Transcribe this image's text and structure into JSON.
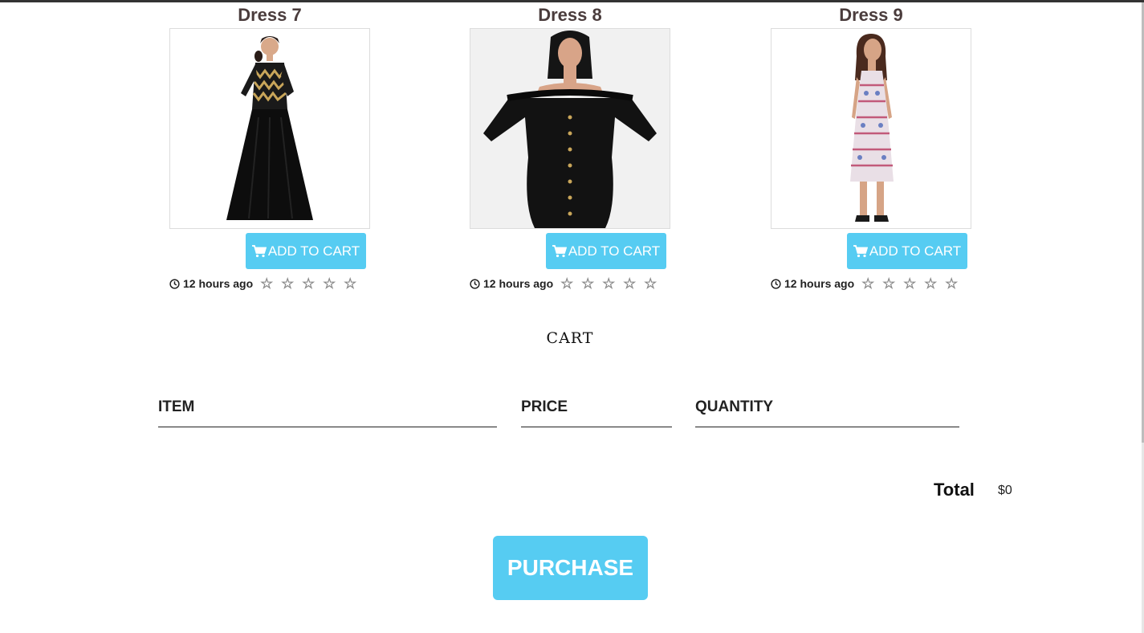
{
  "products": [
    {
      "name": "Dress 7",
      "add_label": "ADD TO CART",
      "time": "12 hours ago",
      "rating": 0,
      "photo_label": "woman in black gown with chevron-pattern bodice"
    },
    {
      "name": "Dress 8",
      "add_label": "ADD TO CART",
      "time": "12 hours ago",
      "rating": 0,
      "photo_label": "woman in black off-shoulder bodycon dress"
    },
    {
      "name": "Dress 9",
      "add_label": "ADD TO CART",
      "time": "12 hours ago",
      "rating": 0,
      "photo_label": "woman in patterned halter dress"
    }
  ],
  "cart": {
    "title": "CART",
    "columns": [
      "ITEM",
      "PRICE",
      "QUANTITY"
    ],
    "items": [],
    "total_label": "Total",
    "total_value": "$0",
    "purchase_label": "PURCHASE"
  },
  "colors": {
    "accent": "#56ccf2",
    "title_text": "#4a3c3c",
    "star": "#8a8a8a"
  }
}
